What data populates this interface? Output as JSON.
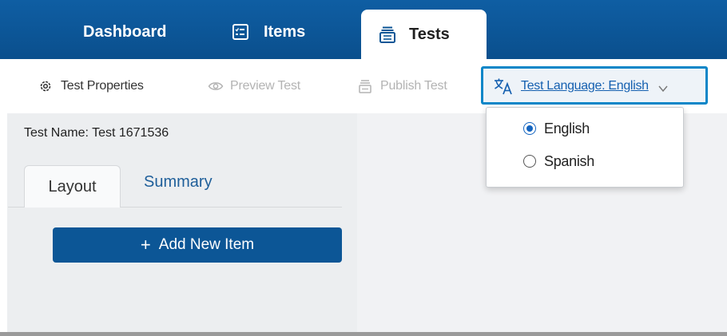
{
  "nav": {
    "dashboard": "Dashboard",
    "items": "Items",
    "tests": "Tests",
    "icons": {
      "items": "checklist-icon",
      "tests": "test-stack-icon"
    }
  },
  "toolbar": {
    "properties": "Test Properties",
    "preview": "Preview Test",
    "publish": "Publish Test",
    "language": "Test Language: English",
    "icons": {
      "properties": "gear-icon",
      "preview": "eye-icon",
      "publish": "publish-icon",
      "language": "translate-icon",
      "chevron": "chevron-down-icon"
    }
  },
  "left": {
    "test_name": "Test Name: Test 1671536",
    "tabs": [
      "Layout",
      "Summary"
    ],
    "add_button": "Add New Item"
  },
  "dropdown": {
    "options": [
      "English",
      "Spanish"
    ],
    "selected": "English"
  },
  "colors": {
    "nav_bg": "#0a4f8d",
    "accent": "#0a86c8",
    "link": "#1560b0",
    "button": "#0c5696"
  }
}
